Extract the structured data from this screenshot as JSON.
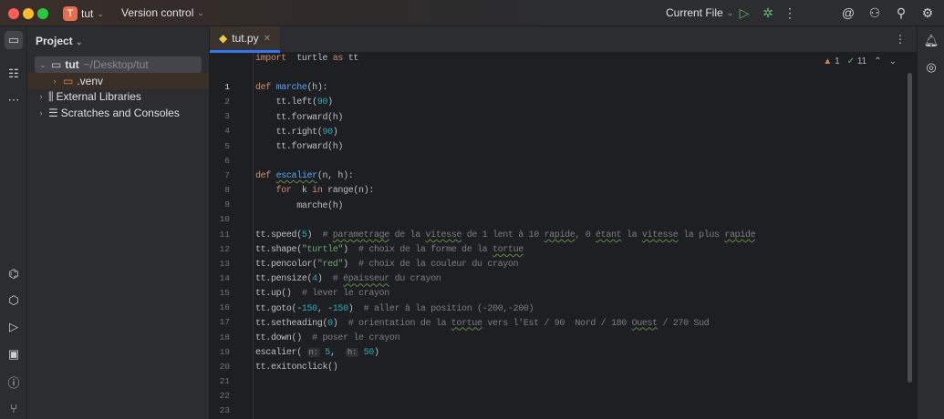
{
  "titlebar": {
    "project_initial": "T",
    "project_name": "tut",
    "vcs": "Version control",
    "run_config": "Current File"
  },
  "project_panel": {
    "title": "Project",
    "tree": [
      {
        "name": "tut",
        "path": "~/Desktop/tut"
      },
      {
        "name": ".venv"
      },
      {
        "name": "External Libraries"
      },
      {
        "name": "Scratches and Consoles"
      }
    ]
  },
  "editor": {
    "tab": "tut.py",
    "warnings": "1",
    "checks": "11",
    "lines": [
      [
        [
          "kw",
          "import"
        ],
        [
          "",
          "  turtle "
        ],
        [
          "kw",
          "as"
        ],
        [
          "",
          " tt"
        ]
      ],
      [],
      [
        [
          "kw",
          "def "
        ],
        [
          "fn",
          "marche"
        ],
        [
          "",
          "(h):"
        ]
      ],
      [
        [
          "",
          "    tt.left("
        ],
        [
          "num",
          "90"
        ],
        [
          "",
          ")"
        ]
      ],
      [
        [
          "",
          "    tt.forward(h)"
        ]
      ],
      [
        [
          "",
          "    tt.right("
        ],
        [
          "num",
          "90"
        ],
        [
          "",
          ")"
        ]
      ],
      [
        [
          "",
          "    tt.forward(h)"
        ]
      ],
      [],
      [
        [
          "kw",
          "def "
        ],
        [
          "fn sq",
          "escalier"
        ],
        [
          "",
          "(n, h):"
        ]
      ],
      [
        [
          "kw",
          "    for "
        ],
        [
          "",
          " k "
        ],
        [
          "kw",
          "in"
        ],
        [
          "",
          " range(n):"
        ]
      ],
      [
        [
          "",
          "        marche(h)"
        ]
      ],
      [],
      [
        [
          "",
          "tt.speed("
        ],
        [
          "num",
          "5"
        ],
        [
          "",
          ")  "
        ],
        [
          "cm",
          "# "
        ],
        [
          "cm sq",
          "parametrage"
        ],
        [
          "cm",
          " de la "
        ],
        [
          "cm sq",
          "vitesse"
        ],
        [
          "cm",
          " de 1 lent à 10 "
        ],
        [
          "cm sq",
          "rapide"
        ],
        [
          "cm",
          ", 0 "
        ],
        [
          "cm sq",
          "étant"
        ],
        [
          "cm",
          " la "
        ],
        [
          "cm sq",
          "vitesse"
        ],
        [
          "cm",
          " la plus "
        ],
        [
          "cm sq",
          "rapide"
        ]
      ],
      [
        [
          "",
          "tt.shape("
        ],
        [
          "str",
          "\"turtle\""
        ],
        [
          "",
          ")  "
        ],
        [
          "cm",
          "# choix de la forme de la "
        ],
        [
          "cm sq",
          "tortue"
        ]
      ],
      [
        [
          "",
          "tt.pencolor("
        ],
        [
          "str",
          "\"red\""
        ],
        [
          "",
          ")  "
        ],
        [
          "cm",
          "# choix de la couleur du crayon"
        ]
      ],
      [
        [
          "",
          "tt.pensize("
        ],
        [
          "num",
          "4"
        ],
        [
          "",
          ")  "
        ],
        [
          "cm",
          "# "
        ],
        [
          "cm sq",
          "épaisseur"
        ],
        [
          "cm",
          " du crayon"
        ]
      ],
      [
        [
          "",
          "tt.up()  "
        ],
        [
          "cm",
          "# lever le crayon"
        ]
      ],
      [
        [
          "",
          "tt.goto(-"
        ],
        [
          "num",
          "150"
        ],
        [
          "",
          ", -"
        ],
        [
          "num",
          "150"
        ],
        [
          "",
          ")  "
        ],
        [
          "cm",
          "# aller à la position (-200,-200)"
        ]
      ],
      [
        [
          "",
          "tt.setheading("
        ],
        [
          "num",
          "0"
        ],
        [
          "",
          ")  "
        ],
        [
          "cm",
          "# orientation de la "
        ],
        [
          "cm sq",
          "tortue"
        ],
        [
          "cm",
          " vers l'Est / 90  Nord / 180 "
        ],
        [
          "cm sq",
          "Ouest"
        ],
        [
          "cm",
          " / 270 Sud"
        ]
      ],
      [
        [
          "",
          "tt.down()  "
        ],
        [
          "cm",
          "# poser le crayon"
        ]
      ],
      [
        [
          "",
          "escalier( "
        ],
        [
          "hint",
          "n:"
        ],
        [
          "num",
          " 5"
        ],
        [
          "",
          ",  "
        ],
        [
          "hint",
          "h:"
        ],
        [
          "num",
          " 50"
        ],
        [
          "",
          ")"
        ]
      ],
      [
        [
          "",
          "tt.exitonclick()"
        ]
      ],
      []
    ]
  }
}
